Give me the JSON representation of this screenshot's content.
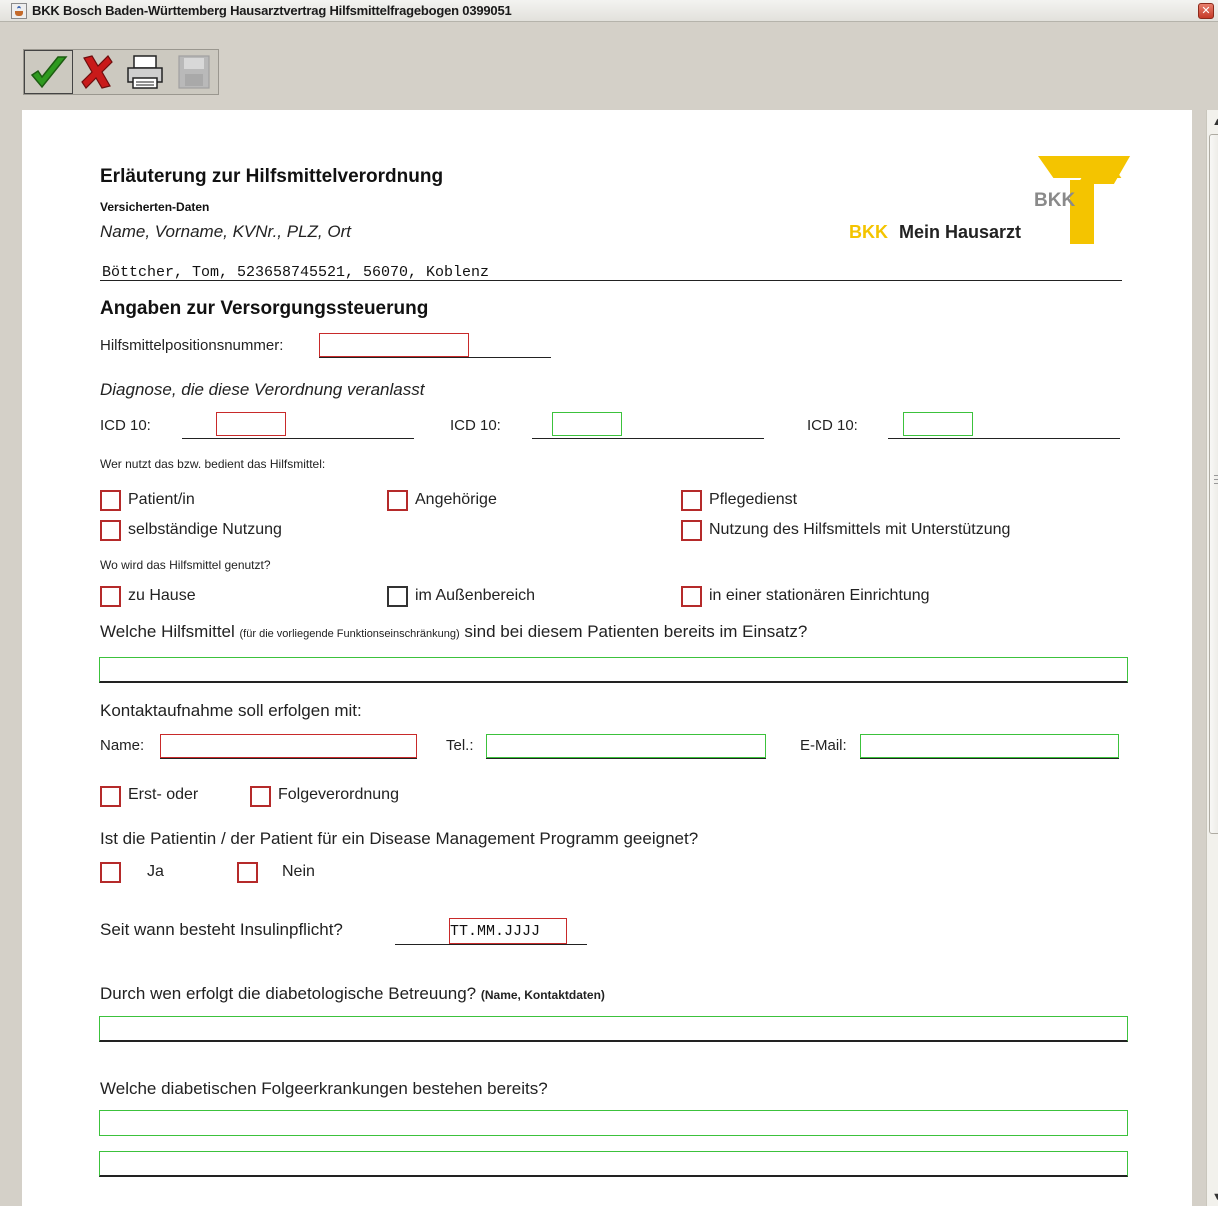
{
  "window": {
    "title": "BKK Bosch Baden-Württemberg Hausarztvertrag Hilfsmittelfragebogen 0399051"
  },
  "toolbar": {
    "buttons": [
      "confirm",
      "cancel",
      "print",
      "save-disabled"
    ]
  },
  "form": {
    "heading": "Erläuterung zur Hilfsmittelverordnung",
    "insured_label": "Versicherten-Daten",
    "insured_fields_label": "Name, Vorname, KVNr., PLZ, Ort",
    "insured_value": "Böttcher, Tom, 523658745521, 56070, Koblenz",
    "logo": {
      "brand": "BKK",
      "brand_small": "BKK",
      "tagline": "Mein Hausarzt"
    },
    "section_care": "Angaben zur Versorgungssteuerung",
    "position_label": "Hilfsmittelpositionsnummer:",
    "diagnosis_label": "Diagnose, die diese Verordnung veranlasst",
    "icd_label": "ICD 10:",
    "who_uses_label": "Wer nutzt das bzw. bedient das Hilfsmittel:",
    "who_options": {
      "patient": "Patient/in",
      "relatives": "Angehörige",
      "care_service": "Pflegedienst",
      "independent": "selbständige Nutzung",
      "with_support": "Nutzung des Hilfsmittels mit Unterstützung"
    },
    "where_label": "Wo wird das Hilfsmittel genutzt?",
    "where_options": {
      "home": "zu Hause",
      "outdoor": "im Außenbereich",
      "inpatient": "in einer stationären Einrichtung"
    },
    "aids_q_start": "Welche Hilfsmittel",
    "aids_q_note": "(für die vorliegende Funktionseinschränkung)",
    "aids_q_end": "sind bei diesem Patienten bereits im Einsatz?",
    "contact_label": "Kontaktaufnahme soll erfolgen mit:",
    "contact_name": "Name:",
    "contact_tel": "Tel.:",
    "contact_email": "E-Mail:",
    "first_or": "Erst- oder",
    "follow_up": "Folgeverordnung",
    "dmp_question": "Ist die Patientin / der Patient für ein Disease Management Programm geeignet?",
    "yes": "Ja",
    "no": "Nein",
    "insulin_question": "Seit wann besteht Insulinpflicht?",
    "insulin_placeholder": "TT.MM.JJJJ",
    "diabetology_question": "Durch wen erfolgt die diabetologische Betreuung?",
    "diabetology_note": "(Name, Kontaktdaten)",
    "complications_question": "Welche diabetischen Folgeerkrankungen bestehen bereits?"
  },
  "colors": {
    "required_border": "#c82a2a",
    "optional_border": "#3cc23c",
    "logo_yellow": "#f4c400"
  }
}
